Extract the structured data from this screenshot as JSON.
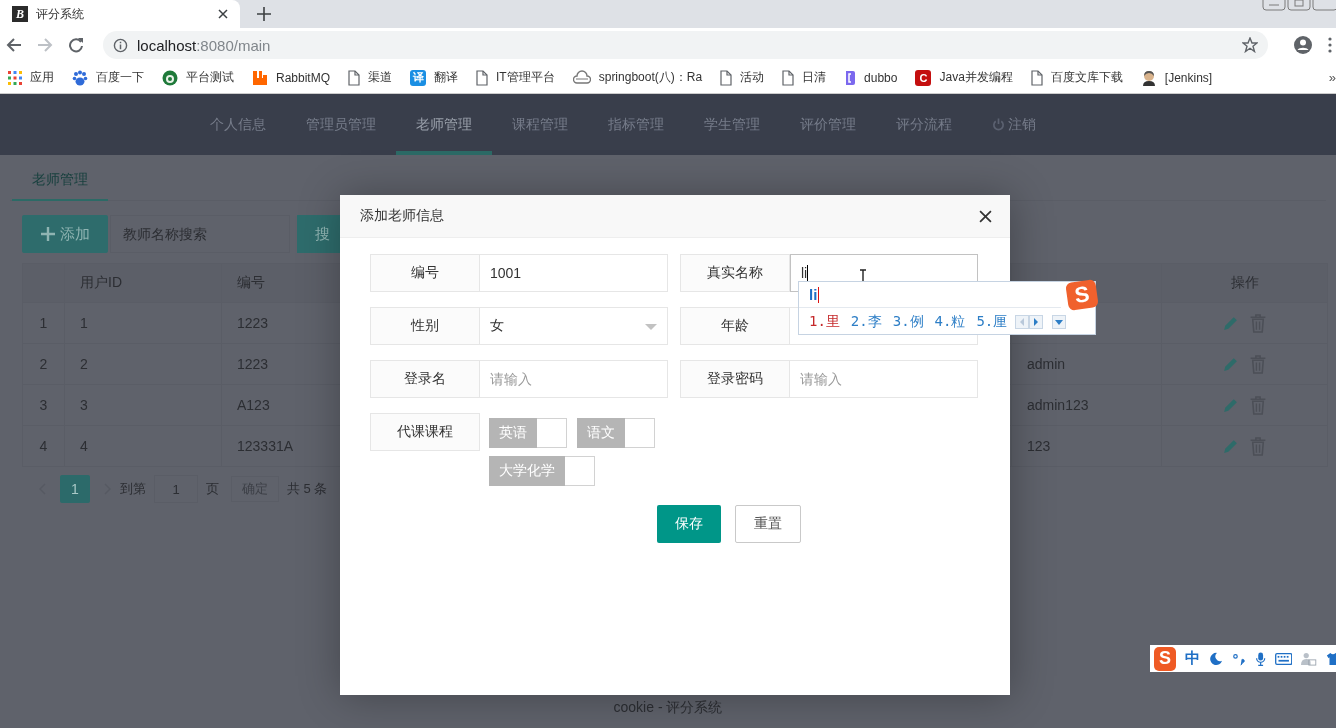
{
  "browser": {
    "tab": {
      "favicon_text": "B",
      "title": "评分系统"
    },
    "url": {
      "host": "localhost",
      "path": ":8080/main"
    },
    "bookmarks": [
      {
        "kind": "apps",
        "label": "应用"
      },
      {
        "kind": "paw",
        "label": "百度一下"
      },
      {
        "kind": "round",
        "label": "平台测试"
      },
      {
        "kind": "rabbit",
        "label": "RabbitMQ"
      },
      {
        "kind": "page",
        "label": "渠道"
      },
      {
        "kind": "badge",
        "badge": "译",
        "label": "翻译"
      },
      {
        "kind": "page",
        "label": "IT管理平台"
      },
      {
        "kind": "cloud",
        "label": "springboot(八)：Ra"
      },
      {
        "kind": "page",
        "label": "活动"
      },
      {
        "kind": "page",
        "label": "日清"
      },
      {
        "kind": "bracket",
        "label": "dubbo"
      },
      {
        "kind": "redbadge",
        "badge": "C",
        "label": "Java并发编程"
      },
      {
        "kind": "page",
        "label": "百度文库下载"
      },
      {
        "kind": "person",
        "label": "[Jenkins]"
      }
    ],
    "overflow": "»"
  },
  "nav": [
    {
      "label": "个人信息",
      "selected": false,
      "kind": "link"
    },
    {
      "label": "管理员管理",
      "selected": false,
      "kind": "link"
    },
    {
      "label": "老师管理",
      "selected": true,
      "kind": "link"
    },
    {
      "label": "课程管理",
      "selected": false,
      "kind": "link"
    },
    {
      "label": "指标管理",
      "selected": false,
      "kind": "link"
    },
    {
      "label": "学生管理",
      "selected": false,
      "kind": "link"
    },
    {
      "label": "评价管理",
      "selected": false,
      "kind": "link"
    },
    {
      "label": "评分流程",
      "selected": false,
      "kind": "link"
    },
    {
      "label": "注销",
      "selected": false,
      "kind": "logout"
    }
  ],
  "page_tab": "老师管理",
  "toolbar": {
    "add_button": "添加",
    "search_placeholder": "教师名称搜索",
    "search_button": "搜"
  },
  "table": {
    "headers": {
      "user_id": "用户ID",
      "number": "编号",
      "actions": "操作"
    },
    "rows": [
      {
        "index": "1",
        "user_id": "1",
        "number": "1223"
      },
      {
        "index": "2",
        "user_id": "2",
        "number": "1223",
        "column_5": "admin"
      },
      {
        "index": "3",
        "user_id": "3",
        "number": "A123",
        "column_5": "admin123"
      },
      {
        "index": "4",
        "user_id": "4",
        "number": "123331A",
        "column_5": "123"
      }
    ]
  },
  "pagination": {
    "pages": [
      {
        "label": "1",
        "selected": true
      }
    ],
    "goto_label": "到第",
    "goto_value": "1",
    "page_unit": "页",
    "confirm": "确定",
    "total": "共 5 条"
  },
  "footer": "cookie - 评分系统",
  "dialog": {
    "title": "添加老师信息",
    "fields": [
      {
        "label": "编号",
        "kind": "input",
        "value": "1001",
        "focused": false
      },
      {
        "label": "真实名称",
        "kind": "input",
        "value": "li",
        "focused": true
      },
      {
        "label": "性别",
        "kind": "select",
        "value": "女",
        "focused": false
      },
      {
        "label": "年龄",
        "kind": "input",
        "focused": false
      },
      {
        "label": "登录名",
        "kind": "input",
        "placeholder": "请输入",
        "focused": false
      },
      {
        "label": "登录密码",
        "kind": "input",
        "placeholder": "请输入",
        "focused": false
      }
    ],
    "courses_label": "代课课程",
    "courses": [
      {
        "label": "英语",
        "checked": false
      },
      {
        "label": "语文",
        "checked": false
      },
      {
        "label": "大学化学",
        "checked": false
      }
    ],
    "buttons": [
      {
        "label": "保存",
        "kind": "primary"
      },
      {
        "label": "重置",
        "kind": "plain"
      }
    ]
  },
  "ime": {
    "logo_text": "S",
    "composition": "li",
    "candidates": [
      {
        "label": "1.里",
        "selected": true
      },
      {
        "label": "2.李",
        "selected": false
      },
      {
        "label": "3.例",
        "selected": false
      },
      {
        "label": "4.粒",
        "selected": false
      },
      {
        "label": "5.厘",
        "selected": false
      }
    ]
  },
  "ime_bar": {
    "logo_text": "S",
    "mode": "中"
  }
}
